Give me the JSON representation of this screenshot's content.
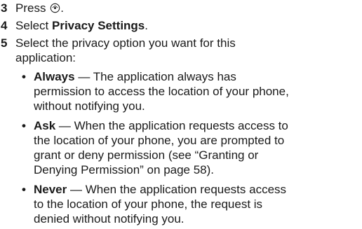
{
  "steps": [
    {
      "number": "3",
      "text": "Press",
      "trailing": ".",
      "icon": "select-key-icon"
    },
    {
      "number": "4",
      "prefix": "Select ",
      "bold": "Privacy Settings",
      "suffix": "."
    },
    {
      "number": "5",
      "line1": "Select the privacy option you want for this",
      "line2": "application:"
    }
  ],
  "options": [
    {
      "term": "Always",
      "line1_rest": " — The application always has",
      "lines": [
        "permission to access the location of your phone,",
        "without notifying you."
      ]
    },
    {
      "term": "Ask",
      "line1_rest": " — When the application requests access to",
      "lines": [
        "the location of your phone, you are prompted to",
        "grant or deny permission (see “Granting or",
        "Denying Permission” on page 58)."
      ]
    },
    {
      "term": "Never",
      "line1_rest": " — When the application requests access",
      "lines": [
        "to the location of your phone, the request is",
        "denied without notifying you."
      ]
    }
  ],
  "bullet_glyph": "•"
}
